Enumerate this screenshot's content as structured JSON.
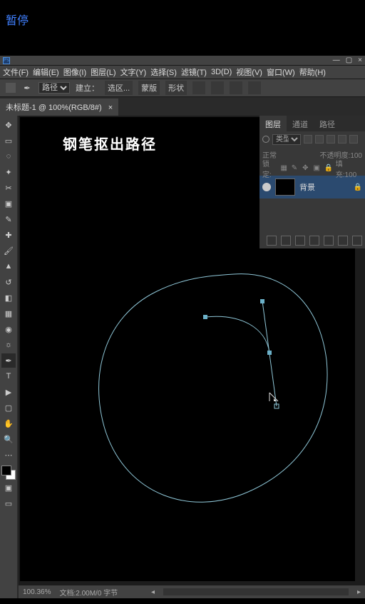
{
  "overlay": {
    "pause": "暂停"
  },
  "menu": {
    "file": "文件(F)",
    "edit": "编辑(E)",
    "image": "图像(I)",
    "layer": "图层(L)",
    "type": "文字(Y)",
    "select": "选择(S)",
    "filter": "滤镜(T)",
    "view3d": "3D(D)",
    "view": "视图(V)",
    "window": "窗口(W)",
    "help": "帮助(H)"
  },
  "options": {
    "mode": "路径",
    "create_label": "建立：",
    "selection": "选区...",
    "mask": "蒙版",
    "shape": "形状"
  },
  "doc": {
    "tab_title": "未标题-1 @ 100%(RGB/8#)",
    "close": "×"
  },
  "canvas": {
    "heading": "钢笔抠出路径"
  },
  "status": {
    "zoom": "100.36%",
    "doc_info": "文档:2.00M/0 字节"
  },
  "panels": {
    "tabs": {
      "layers": "图层",
      "channels": "通道",
      "paths": "路径"
    },
    "filter_kind": "类型",
    "blend_mode": "正常",
    "opacity_label": "不透明度:",
    "opacity_value": "100",
    "lock_label": "锁定:",
    "fill_label": "填充:",
    "fill_value": "100",
    "layers": [
      {
        "name": "背景"
      }
    ]
  },
  "icons": {
    "home": "⌂",
    "pen": "✒",
    "path_combine": "▣",
    "align": "≡",
    "gear": "⚙"
  },
  "chart_data": null
}
